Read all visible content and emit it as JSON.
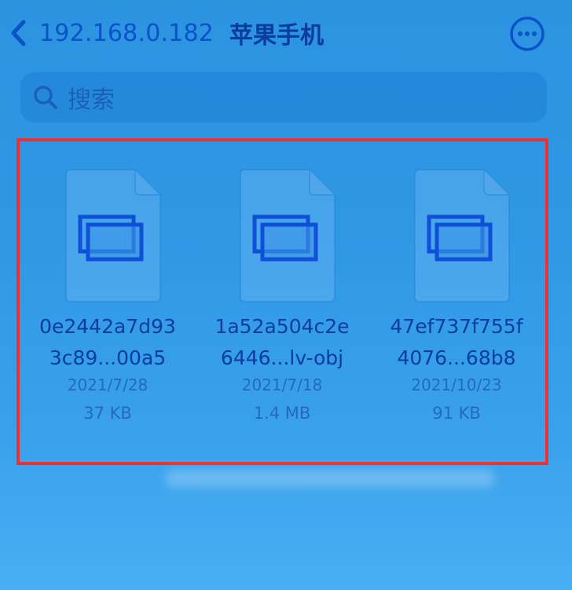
{
  "navbar": {
    "back_label": "192.168.0.182",
    "title": "苹果手机",
    "back_icon": "chevron-left-icon",
    "more_icon": "ellipsis-circle-icon"
  },
  "search": {
    "placeholder": "搜索",
    "icon": "search-icon"
  },
  "files": [
    {
      "name_line1": "0e2442a7d93",
      "name_line2": "3c89...00a5",
      "date": "2021/7/28",
      "size": "37 KB",
      "icon": "file-icon"
    },
    {
      "name_line1": "1a52a504c2e",
      "name_line2": "6446...lv-obj",
      "date": "2021/7/18",
      "size": "1.4 MB",
      "icon": "file-icon"
    },
    {
      "name_line1": "47ef737f755f",
      "name_line2": "4076...68b8",
      "date": "2021/10/23",
      "size": "91 KB",
      "icon": "file-icon"
    }
  ],
  "colors": {
    "accent": "#0a52c8",
    "highlight": "#f03030",
    "background": "#2f98e5"
  }
}
